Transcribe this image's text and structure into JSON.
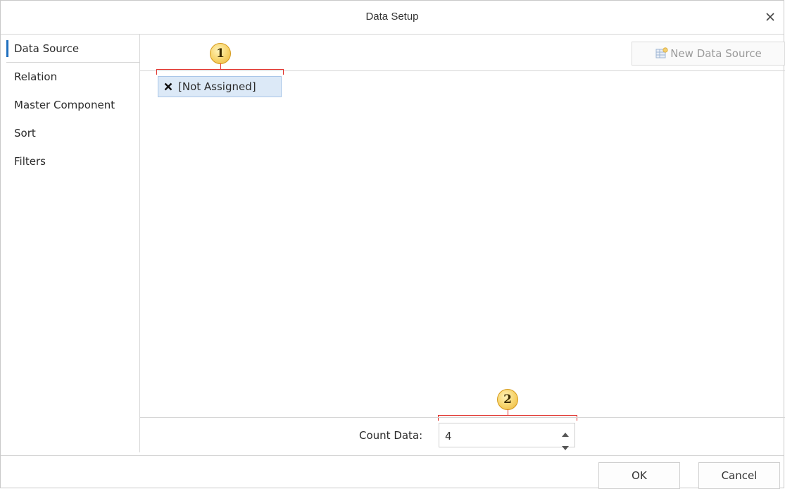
{
  "dialog": {
    "title": "Data Setup",
    "close_icon": "close-icon"
  },
  "sidebar": {
    "items": [
      {
        "label": "Data Source",
        "active": true
      },
      {
        "label": "Relation",
        "active": false
      },
      {
        "label": "Master Component",
        "active": false
      },
      {
        "label": "Sort",
        "active": false
      },
      {
        "label": "Filters",
        "active": false
      }
    ]
  },
  "toolbar": {
    "new_data_source_label": "New Data Source",
    "new_data_source_icon": "new-data-source-icon",
    "new_data_source_enabled": false
  },
  "data_source": {
    "selected_label": "[Not Assigned]",
    "selected_icon": "x-icon"
  },
  "count_data": {
    "label": "Count Data:",
    "value": "4"
  },
  "callouts": {
    "first": "1",
    "second": "2"
  },
  "footer": {
    "ok_label": "OK",
    "cancel_label": "Cancel"
  },
  "colors": {
    "accent": "#1f6fbf",
    "selection_bg": "#dce9f7",
    "callout_fill": "#f7d36a",
    "bracket": "#e0302a"
  }
}
